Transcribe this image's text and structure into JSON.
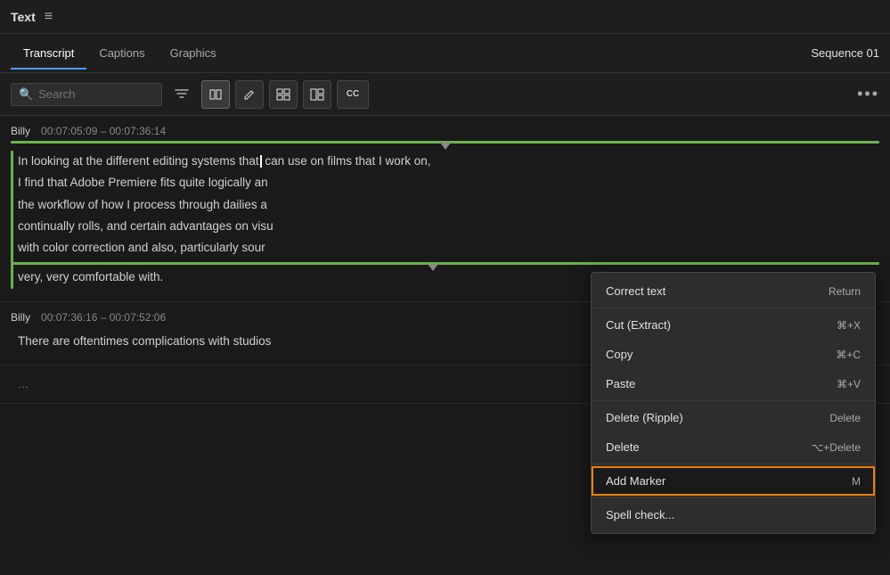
{
  "titleBar": {
    "title": "Text",
    "menuIcon": "≡"
  },
  "tabs": [
    {
      "id": "transcript",
      "label": "Transcript",
      "active": true
    },
    {
      "id": "captions",
      "label": "Captions",
      "active": false
    },
    {
      "id": "graphics",
      "label": "Graphics",
      "active": false
    }
  ],
  "sequence": "Sequence 01",
  "toolbar": {
    "searchPlaceholder": "Search",
    "searchValue": "",
    "filterIcon": "▽",
    "splitIcon": "⊢",
    "editIcon": "✎",
    "groupIcon1": "⊞",
    "groupIcon2": "⊟",
    "ccIcon": "CC",
    "moreIcon": "•••"
  },
  "transcript": {
    "entries": [
      {
        "id": 1,
        "speaker": "Billy",
        "timestamp": "00:07:05:09 – 00:07:36:14",
        "lines": [
          "In looking at the different editing systems that| can use on films that I work on,",
          "I find that Adobe Premiere fits quite logically an",
          "the workflow of how I process through dailies a",
          "continually rolls, and certain advantages on visu",
          "with color correction and also, particularly sour",
          "very, very comfortable with."
        ],
        "hasSelection": true
      },
      {
        "id": 2,
        "speaker": "Billy",
        "timestamp": "00:07:36:16 – 00:07:52:06",
        "lines": [
          "There are oftentimes complications with studios",
          ""
        ],
        "hasSelection": false
      }
    ]
  },
  "contextMenu": {
    "items": [
      {
        "id": "correct-text",
        "label": "Correct text",
        "shortcut": "Return",
        "highlighted": false
      },
      {
        "id": "cut-extract",
        "label": "Cut (Extract)",
        "shortcut": "⌘+X",
        "highlighted": false
      },
      {
        "id": "copy",
        "label": "Copy",
        "shortcut": "⌘+C",
        "highlighted": false
      },
      {
        "id": "paste",
        "label": "Paste",
        "shortcut": "⌘+V",
        "highlighted": false
      },
      {
        "id": "delete-ripple",
        "label": "Delete (Ripple)",
        "shortcut": "Delete",
        "highlighted": false
      },
      {
        "id": "delete",
        "label": "Delete",
        "shortcut": "⌥+Delete",
        "highlighted": false
      },
      {
        "id": "add-marker",
        "label": "Add Marker",
        "shortcut": "M",
        "highlighted": true
      },
      {
        "id": "spell-check",
        "label": "Spell check...",
        "shortcut": "",
        "highlighted": false
      }
    ]
  }
}
